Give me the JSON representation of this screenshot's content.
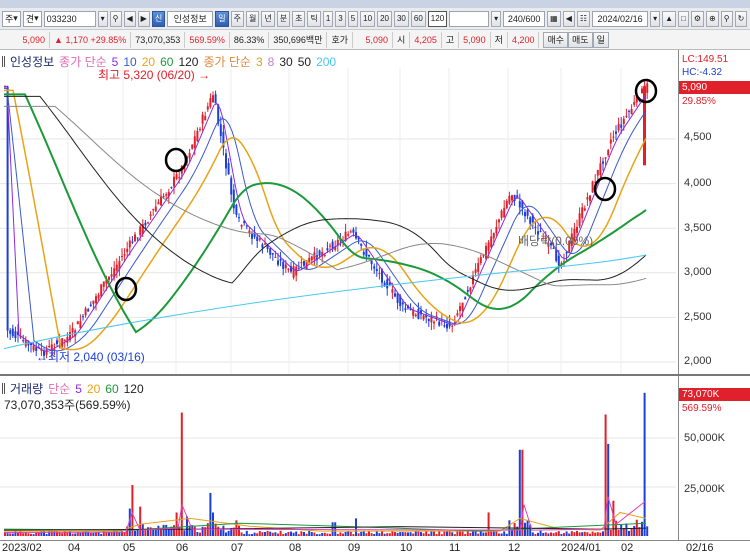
{
  "toolbar": {
    "mode": "주",
    "period_mode": "견",
    "code": "033230",
    "info_tab": "신",
    "name": "인성정보",
    "period_tab": "일",
    "periods": [
      "주",
      "월",
      "년",
      "분",
      "초",
      "틱"
    ],
    "numbers": [
      "1",
      "3",
      "5",
      "10",
      "20",
      "30",
      "60",
      "120"
    ],
    "count": "240/600",
    "date": "2024/02/16"
  },
  "quote": {
    "price": "5,090",
    "change": "1,170",
    "change_pct": "+29.85%",
    "volume": "73,070,353",
    "vol_pct": "569.59%",
    "turnover": "86.33%",
    "amount": "350,696백만",
    "ho_label": "호가",
    "ho_value": "5,090",
    "open_label": "시",
    "open": "4,205",
    "high_label": "고",
    "high": "5,090",
    "low_label": "저",
    "low": "4,200",
    "buy": "매수",
    "sell": "매도",
    "list": "일"
  },
  "price_legend": {
    "name": "인성정보",
    "ma_label": "종가 단순",
    "ma": [
      "5",
      "10",
      "20",
      "60",
      "120"
    ],
    "ma2_label": "종가 단순",
    "ma2": [
      "3",
      "8",
      "30",
      "50",
      "200"
    ],
    "high_note": "최고 5,320 (06/20)",
    "low_note": "최저 2,040 (03/16)",
    "dividend_note": "배당락(0.00%)"
  },
  "right_panel": {
    "lc": "LC:149.51",
    "hc": "HC:-4.32",
    "price": "5,090",
    "pct": "29.85%",
    "ticks": [
      "4,500",
      "4,000",
      "3,500",
      "3,000",
      "2,500",
      "2,000"
    ]
  },
  "volume_panel": {
    "name": "거래량",
    "ma_label": "단순",
    "ma": [
      "5",
      "20",
      "60",
      "120"
    ],
    "value_text": "73,070,353주(569.59%)",
    "badge": "73,070K",
    "pct": "569.59%",
    "ticks": [
      "50,000K",
      "25,000K"
    ]
  },
  "x_axis": {
    "labels": [
      "2023/02",
      "04",
      "05",
      "06",
      "07",
      "08",
      "09",
      "10",
      "11",
      "12",
      "2024/01",
      "02"
    ],
    "end": "02/16"
  },
  "colors": {
    "up": "#e0202a",
    "down": "#1c3fd8",
    "ma5": "#8a2be2",
    "ma10": "#3b5ac9",
    "ma20": "#e8a317",
    "ma60": "#1b9a3a",
    "ma120": "#222222",
    "ma200": "#48c8f0"
  },
  "chart_data": {
    "type": "candlestick",
    "y_range": [
      1900,
      5500
    ],
    "x_periods": [
      "2023/02",
      "04",
      "05",
      "06",
      "07",
      "08",
      "09",
      "10",
      "11",
      "12",
      "2024/01",
      "02"
    ],
    "close_trend": [
      {
        "x": "2023/02",
        "y": 2350
      },
      {
        "x": "03/16",
        "y": 2100
      },
      {
        "x": "04",
        "y": 2300
      },
      {
        "x": "05",
        "y": 3250
      },
      {
        "x": "06",
        "y": 4150
      },
      {
        "x": "06/20",
        "y": 5000
      },
      {
        "x": "07",
        "y": 3600
      },
      {
        "x": "08",
        "y": 3000
      },
      {
        "x": "09",
        "y": 3450
      },
      {
        "x": "10",
        "y": 2600
      },
      {
        "x": "11",
        "y": 2400
      },
      {
        "x": "12",
        "y": 3900
      },
      {
        "x": "2024/01",
        "y": 3100
      },
      {
        "x": "02",
        "y": 4500
      },
      {
        "x": "02/16",
        "y": 5090
      }
    ],
    "high": {
      "date": "06/20",
      "value": 5320
    },
    "low": {
      "date": "03/16",
      "value": 2040
    },
    "volume_ticks_k": [
      25000,
      50000
    ],
    "last_volume_k": 73070
  }
}
